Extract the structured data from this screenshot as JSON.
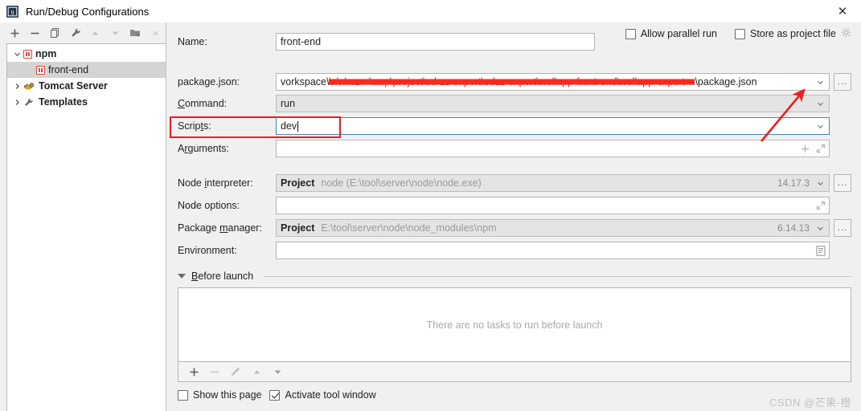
{
  "window": {
    "title": "Run/Debug Configurations",
    "close_label": "✕",
    "app_icon": "intellij-idea-icon"
  },
  "sidebar": {
    "toolbar": [
      {
        "name": "add-configuration-button",
        "glyph": "+"
      },
      {
        "name": "remove-configuration-button",
        "glyph": "−"
      },
      {
        "name": "copy-configuration-button",
        "glyph": "copy-icon"
      },
      {
        "name": "edit-templates-button",
        "glyph": "wrench-icon"
      },
      {
        "name": "move-up-button",
        "glyph": "▲"
      },
      {
        "name": "move-down-button",
        "glyph": "▼"
      },
      {
        "name": "new-folder-button",
        "glyph": "folder-plus-icon"
      },
      {
        "name": "more-options-button",
        "glyph": "»"
      }
    ],
    "tree": [
      {
        "label": "npm",
        "twisty": "expanded",
        "icon": "npm-icon",
        "bold": true,
        "indent": 0,
        "selected": false
      },
      {
        "label": "front-end",
        "twisty": "none",
        "icon": "npm-icon",
        "bold": false,
        "indent": 1,
        "selected": true
      },
      {
        "label": "Tomcat Server",
        "twisty": "collapsed",
        "icon": "tomcat-icon",
        "bold": true,
        "indent": 0,
        "selected": false
      },
      {
        "label": "Templates",
        "twisty": "collapsed",
        "icon": "wrench-icon",
        "bold": true,
        "indent": 0,
        "selected": false
      }
    ]
  },
  "form": {
    "name_label": "Name:",
    "name_value": "front-end",
    "allow_parallel_run": {
      "label": "Allow parallel run",
      "checked": false
    },
    "store_as_project_file": {
      "label": "Store as project file",
      "checked": false
    },
    "package_json": {
      "label": "package.json:",
      "value_visible_start": "vorkspace\\",
      "value_redacted": "\\x\\x\\wzn-kasp\\project\\sd-zz-export\\edzz-export\\wellapp-front-end\\wellapp-export-web",
      "value_visible_end": "\\package.json",
      "browse_label": "..."
    },
    "command": {
      "label": "Command:",
      "value": "run"
    },
    "scripts": {
      "label": "Scripts:",
      "value": "dev",
      "focused": true
    },
    "arguments": {
      "label": "Arguments:",
      "value": "",
      "add_glyph": "+",
      "expand_glyph": "expand-icon"
    },
    "node_interpreter": {
      "label": "Node interpreter:",
      "prefix": "Project",
      "value": "node (E:\\tool\\server\\node\\node.exe)",
      "version": "14.17.3",
      "browse_label": "..."
    },
    "node_options": {
      "label": "Node options:",
      "value": ""
    },
    "package_manager": {
      "label": "Package manager:",
      "prefix": "Project",
      "value": "E:\\tool\\server\\node\\node_modules\\npm",
      "version": "6.14.13",
      "browse_label": "..."
    },
    "environment": {
      "label": "Environment:",
      "value": "",
      "editor_glyph": "list-editor-icon"
    }
  },
  "before_launch": {
    "title": "Before launch",
    "empty_text": "There are no tasks to run before launch",
    "toolbar": [
      {
        "name": "add-task-button",
        "glyph": "+",
        "enabled": true
      },
      {
        "name": "remove-task-button",
        "glyph": "−",
        "enabled": false
      },
      {
        "name": "edit-task-button",
        "glyph": "pencil-icon",
        "enabled": false
      },
      {
        "name": "move-task-up-button",
        "glyph": "▲",
        "enabled": false
      },
      {
        "name": "move-task-down-button",
        "glyph": "▼",
        "enabled": false
      }
    ]
  },
  "footer": {
    "show_this_page": {
      "label": "Show this page",
      "checked": false
    },
    "activate_tool_window": {
      "label": "Activate tool window",
      "checked": true
    }
  },
  "watermark": "CSDN @芒果-橙",
  "annotation_color": "#f11b1b"
}
